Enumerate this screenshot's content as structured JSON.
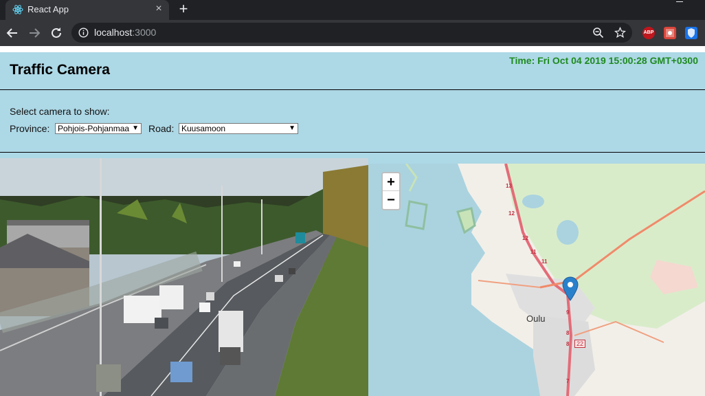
{
  "browser": {
    "tab_title": "React App",
    "tab_close": "×",
    "new_tab": "+",
    "url_host": "localhost",
    "url_port": ":3000",
    "extensions": [
      "ABP"
    ]
  },
  "app": {
    "title": "Traffic Camera",
    "time": "Time: Fri Oct 04 2019 15:00:28 GMT+0300",
    "select_prompt": "Select camera to show:",
    "province_label": "Province:",
    "province_value": "Pohjois-Pohjanmaa",
    "road_label": "Road:",
    "road_value": "Kuusamoon"
  },
  "map": {
    "zoom_in": "+",
    "zoom_out": "−",
    "city_label": "Oulu",
    "road_shields": [
      "13",
      "12",
      "12",
      "11",
      "11",
      "9",
      "8",
      "8",
      "7",
      "22"
    ],
    "marker_color": "#2a81cb"
  },
  "colors": {
    "page_bg": "#add8e6",
    "time_color": "#1e8a1e",
    "chrome_dark": "#202124",
    "chrome_mid": "#35363a"
  }
}
